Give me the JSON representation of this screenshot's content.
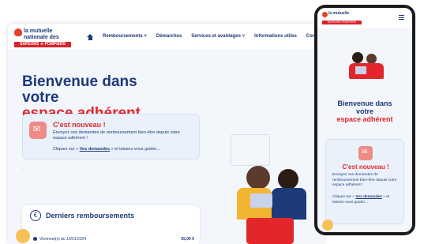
{
  "desktop": {
    "logo": {
      "line1": "la mutuelle",
      "line2": "nationale des",
      "banner": "SAPEURS ★ POMPIERS"
    },
    "nav": {
      "remboursements": "Remboursements ˅",
      "demarches": "Démarches",
      "services": "Services et avantages ˅",
      "informations": "Informations utiles",
      "contact": "Conta"
    },
    "hero": {
      "line1": "Bienvenue dans",
      "line2": "votre",
      "line3": "espace adhérent"
    },
    "new_card": {
      "title": "C'est nouveau !",
      "text": "Envoyez vos demandes de remboursement bien-être depuis votre espace adhérent !",
      "link_prefix": "Cliquez sur « ",
      "link": "Vos demandes",
      "link_suffix": " » et laissez-vous guider..."
    },
    "divider": ".",
    "reimbursements": {
      "icon": "€",
      "title": "Derniers remboursements",
      "rows": [
        {
          "label": "Virement(s) du 16/01/2024",
          "amount": "55,00 €"
        }
      ]
    }
  },
  "phone": {
    "logo": {
      "line1": "la mutuelle",
      "banner": "SAPEURS POMPIERS"
    },
    "hero": {
      "line1": "Bienvenue dans",
      "line2": "votre",
      "line3": "espace adhérent"
    },
    "new_card": {
      "title": "C'est nouveau !",
      "text": "Envoyez vos demandes de remboursement bien-être depuis votre espace adhérent !",
      "link_prefix": "Cliquez sur « ",
      "link": "Vos demandes",
      "link_suffix": " » et laissez-vous guider..."
    }
  },
  "colors": {
    "navy": "#1d3a7a",
    "red": "#e2262b",
    "background": "#f3f6fb",
    "card": "#eaf1fb"
  }
}
